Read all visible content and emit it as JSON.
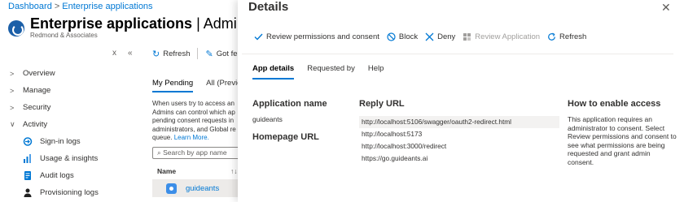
{
  "breadcrumb": {
    "items": [
      "Dashboard",
      "Enterprise applications"
    ],
    "separator": ">"
  },
  "page": {
    "title_main": "Enterprise applications",
    "title_rest": " | Admin conse",
    "subtitle": "Redmond & Associates"
  },
  "left_nav": {
    "items": [
      {
        "chev": ">",
        "label": "Overview"
      },
      {
        "chev": ">",
        "label": "Manage"
      },
      {
        "chev": ">",
        "label": "Security"
      },
      {
        "chev": "∨",
        "label": "Activity"
      }
    ],
    "sub_items": [
      {
        "label": "Sign-in logs",
        "icon": "sign-in-logs-icon"
      },
      {
        "label": "Usage & insights",
        "icon": "usage-insights-icon"
      },
      {
        "label": "Audit logs",
        "icon": "audit-logs-icon"
      },
      {
        "label": "Provisioning logs",
        "icon": "provisioning-logs-icon"
      }
    ],
    "collapse": [
      "x",
      "«"
    ]
  },
  "bg_toolbar": {
    "refresh": "Refresh",
    "got_feedback": "Got fee"
  },
  "bg_tabs": {
    "my_pending": "My Pending",
    "all": "All (Previe"
  },
  "bg_desc": {
    "lines": [
      "When users try to access an",
      "Admins can control which ap",
      "pending consent requests in",
      "administrators, and Global re",
      "queue. "
    ],
    "learn_more": "Learn More."
  },
  "bg_search": {
    "placeholder": "Search by app name"
  },
  "bg_table": {
    "col_name": "Name",
    "sort_icon": "↑↓",
    "row_name": "guideants"
  },
  "details": {
    "title": "Details",
    "close": "✕",
    "toolbar": {
      "review": "Review permissions and consent",
      "block": "Block",
      "deny": "Deny",
      "review_app": "Review Application",
      "refresh": "Refresh"
    },
    "tabs": [
      "App details",
      "Requested by",
      "Help"
    ],
    "application_name_label": "Application name",
    "application_name": "guideants",
    "homepage_url_label": "Homepage URL",
    "reply_url_label": "Reply URL",
    "reply_urls": [
      "http://localhost:5106/swagger/oauth2-redirect.html",
      "http://localhost:5173",
      "http://localhost:3000/redirect",
      "https://go.guideants.ai"
    ],
    "how_label": "How to enable access",
    "how_text": "This application requires an administrator to consent. Select Review permissions and consent to see what permissions are being requested and grant admin consent."
  },
  "colors": {
    "accent": "#0078d4",
    "text": "#323130",
    "muted": "#605e5c",
    "disabled": "#a19f9d"
  }
}
